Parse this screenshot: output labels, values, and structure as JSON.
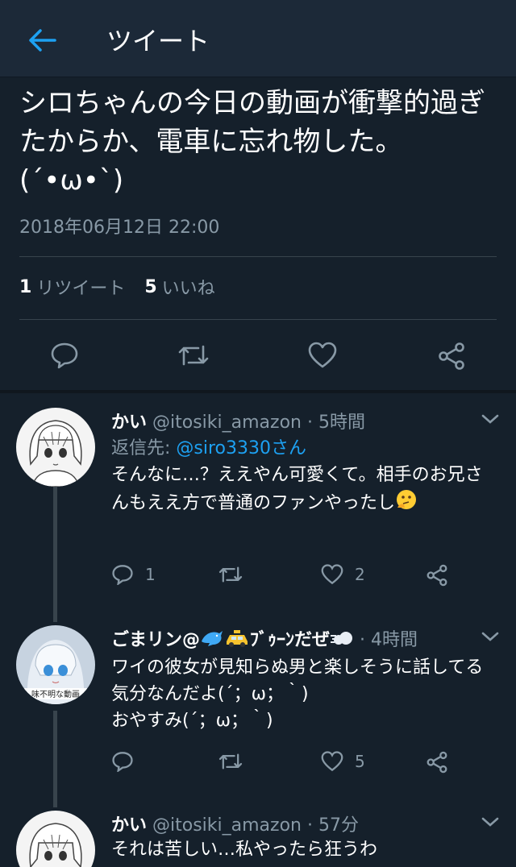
{
  "header": {
    "title": "ツイート"
  },
  "tweet": {
    "text": "シロちゃんの今日の動画が衝撃的過ぎたからか、電車に忘れ物した。(´•ω•`)",
    "timestamp": "2018年06月12日 22:00",
    "retweet_count": "1",
    "retweet_label": "リツイート",
    "like_count": "5",
    "like_label": "いいね"
  },
  "replies": [
    {
      "name": "かい",
      "handle": "@itosiki_amazon",
      "time": "· 5時間",
      "reply_to_prefix": "返信先: ",
      "reply_to_mention": "@siro3330さん",
      "text": "そんなに…？ええやん可愛くて。相手のお兄さんもええ方で普通のファンやったし",
      "reply_count": "1",
      "retweet_count": "",
      "like_count": "2"
    },
    {
      "name": "ごまリン@",
      "name_suffix": "ﾌﾞｩｰﾝだぜ",
      "handle": "",
      "time": "· 4時間",
      "text": "ワイの彼女が見知らぬ男と楽しそうに話してる気分なんだよ(´；ω；｀)\nおやすみ(´；ω；｀)",
      "avatar_caption": "味不明な動画",
      "reply_count": "",
      "retweet_count": "",
      "like_count": "5"
    },
    {
      "name": "かい",
      "handle": "@itosiki_amazon",
      "time": "· 57分",
      "text": "それは苦しい…私やったら狂うわ"
    }
  ],
  "colors": {
    "background": "#15202b",
    "header": "#1c2938",
    "secondary_text": "#8899a6",
    "accent": "#1da1f2"
  }
}
